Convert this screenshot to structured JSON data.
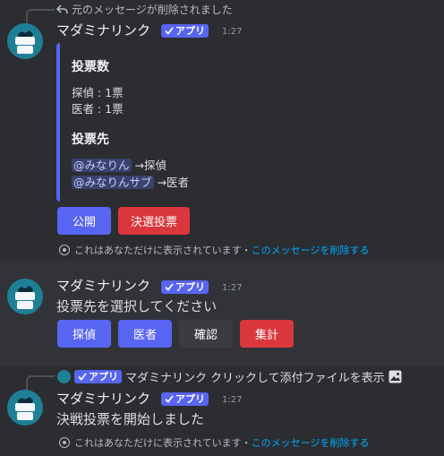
{
  "msg1": {
    "reply_text": "元のメッセージが削除されました",
    "author": "マダミナリンク",
    "app_badge": "アプリ",
    "time": "1:27",
    "embed": {
      "section1_title": "投票数",
      "section1_lines": [
        "探偵 : 1票",
        "医者 : 1票"
      ],
      "section2_title": "投票先",
      "votes": [
        {
          "user": "@みなりん",
          "arrow": "→",
          "target": "探偵"
        },
        {
          "user": "@みなりんサブ",
          "arrow": "→",
          "target": "医者"
        }
      ]
    },
    "buttons": [
      "公開",
      "決選投票"
    ],
    "ephemeral_text": "これはあなただけに表示されています・",
    "ephemeral_link": "このメッセージを削除する"
  },
  "msg2": {
    "author": "マダミナリンク",
    "app_badge": "アプリ",
    "time": "1:27",
    "text": "投票先を選択してください",
    "buttons": [
      "探偵",
      "医者",
      "確認",
      "集計"
    ]
  },
  "msg3": {
    "reply_badge": "アプリ",
    "reply_author": "マダミナリンク",
    "reply_text": "クリックして添付ファイルを表示",
    "author": "マダミナリンク",
    "app_badge": "アプリ",
    "time": "1:27",
    "text": "決戦投票を開始しました",
    "ephemeral_text": "これはあなただけに表示されています・",
    "ephemeral_link": "このメッセージを削除する"
  },
  "icons": {
    "reply": "reply-arrow-icon",
    "check": "checkmark-icon",
    "eye": "eye-icon",
    "image": "image-icon"
  },
  "colors": {
    "background": "#313338",
    "highlight": "#2b2d31",
    "blurple": "#5865f2",
    "red": "#da373c",
    "grey": "#4e5058",
    "link": "#00a8fc"
  }
}
